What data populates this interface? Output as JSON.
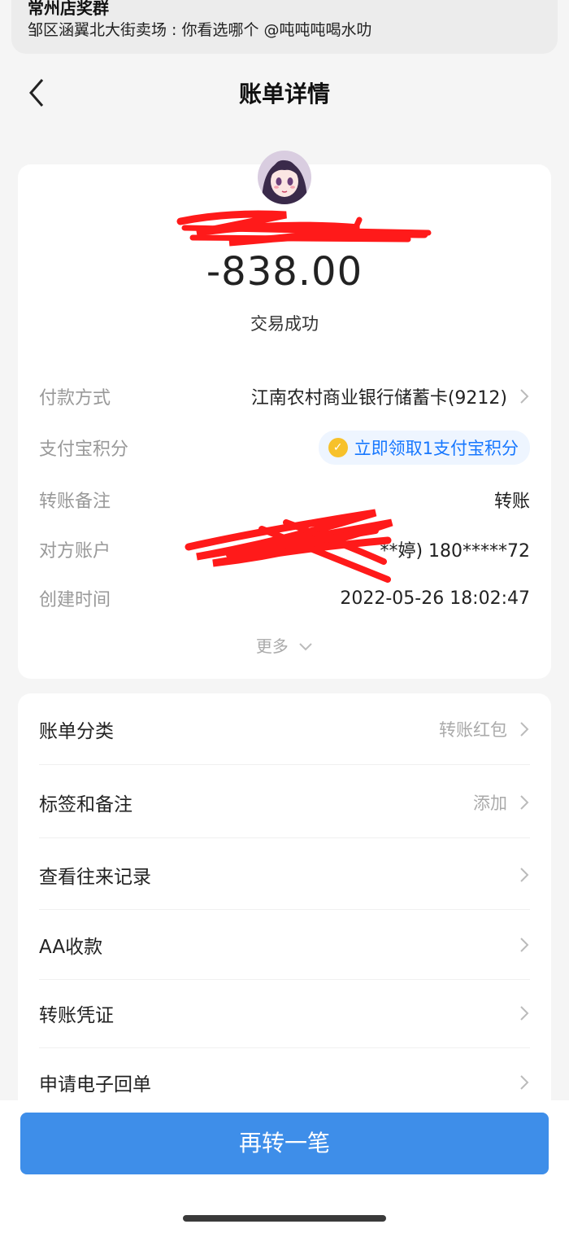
{
  "notification": {
    "title": "常州店奖群",
    "text": "邹区涵翼北大街卖场 : 你看选哪个 @吨吨吨喝水叻"
  },
  "navbar": {
    "title": "账单详情",
    "back_icon": "chevron-left-icon"
  },
  "bill": {
    "payee_name_visible": "",
    "amount": "-838.00",
    "status": "交易成功",
    "rows": [
      {
        "label": "付款方式",
        "value": "江南农村商业银行储蓄卡(9212)"
      },
      {
        "label": "支付宝积分",
        "value": "立即领取1支付宝积分"
      },
      {
        "label": "转账备注",
        "value": "转账"
      },
      {
        "label": "对方账户",
        "value": "**婷) 180*****72"
      },
      {
        "label": "创建时间",
        "value": "2022-05-26 18:02:47"
      }
    ],
    "more": "更多"
  },
  "list": [
    {
      "label": "账单分类",
      "value": "转账红包"
    },
    {
      "label": "标签和备注",
      "value": "添加"
    },
    {
      "label": "查看往来记录",
      "value": ""
    },
    {
      "label": "AA收款",
      "value": ""
    },
    {
      "label": "转账凭证",
      "value": ""
    },
    {
      "label": "申请电子回单",
      "value": ""
    }
  ],
  "bottom": {
    "button": "再转一笔"
  },
  "colors": {
    "accent": "#3e8ee9",
    "link_blue": "#1677ff",
    "redaction": "#ff1a1a"
  }
}
